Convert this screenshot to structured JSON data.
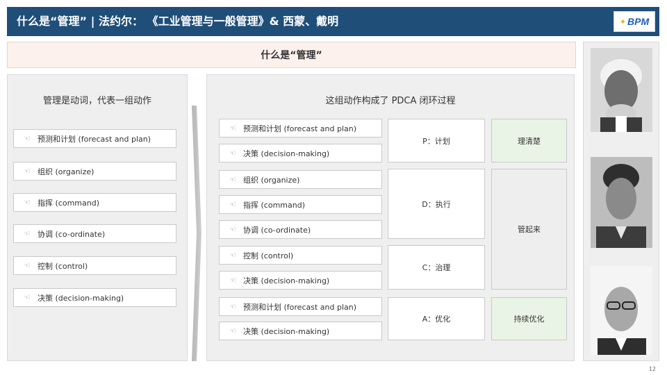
{
  "header": {
    "title": "什么是“管理” | 法约尔： 《工业管理与一般管理》& 西蒙、戴明",
    "logo_text": "BPM"
  },
  "subtitle": "什么是“管理”",
  "left_panel": {
    "heading": "管理是动词，代表一组动作",
    "items": [
      "预测和计划 (forecast and plan)",
      "组织 (organize)",
      "指挥 (command)",
      "协调 (co-ordinate)",
      "控制 (control)",
      "决策 (decision-making)"
    ]
  },
  "right_panel": {
    "heading": "这组动作构成了 PDCA 闭环过程",
    "items": [
      "预测和计划 (forecast and plan)",
      "决策 (decision-making)",
      "组织 (organize)",
      "指挥 (command)",
      "协调 (co-ordinate)",
      "控制 (control)",
      "决策 (decision-making)",
      "预测和计划 (forecast and plan)",
      "决策 (decision-making)"
    ],
    "phases": [
      "P：计划",
      "D：执行",
      "C：治理",
      "A：优化"
    ],
    "results": [
      "理清楚",
      "管起来",
      "持续优化"
    ]
  },
  "page_number": "12",
  "colors": {
    "header_bg": "#1f4e79",
    "subtitle_bg": "#fcf1ec",
    "panel_bg": "#efefef",
    "result_green": "#eaf4e6"
  },
  "icons": {
    "item_icon": "pointing-hand-icon",
    "arrow": "chevron-right-arrow"
  }
}
